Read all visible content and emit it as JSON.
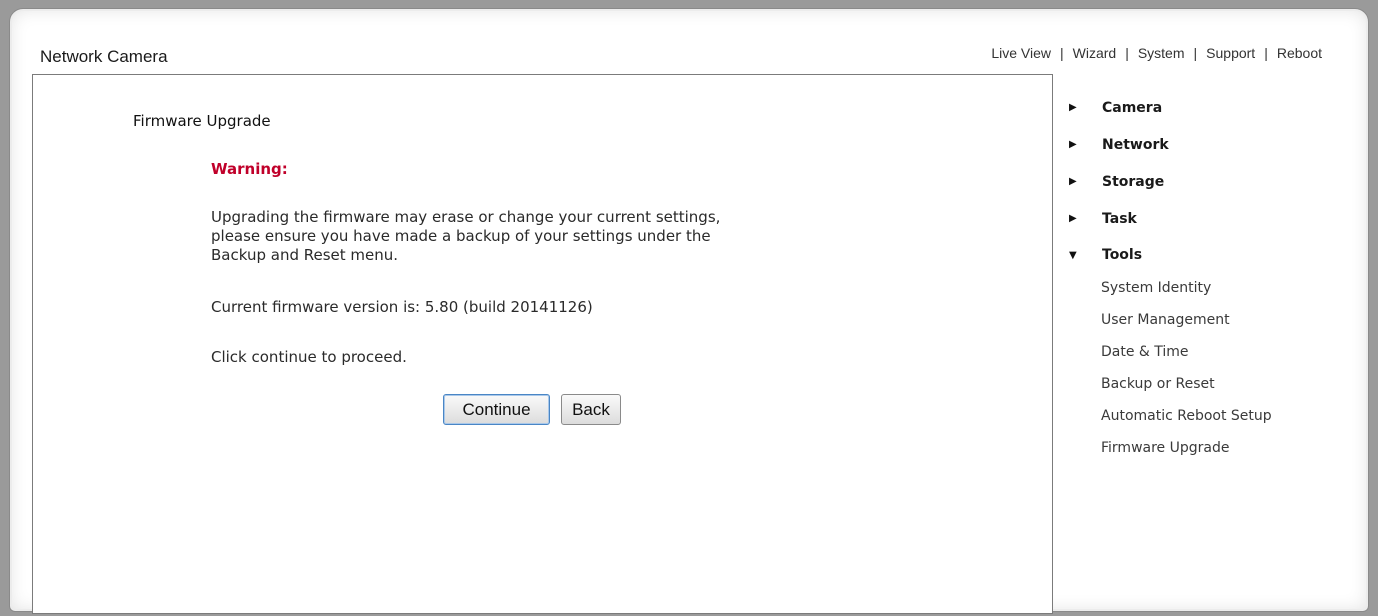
{
  "app": {
    "title": "Network Camera"
  },
  "topnav": {
    "items": [
      "Live View",
      "Wizard",
      "System",
      "Support",
      "Reboot"
    ],
    "separator": "|"
  },
  "main": {
    "page_title": "Firmware Upgrade",
    "warning_heading": "Warning:",
    "warning_text": "Upgrading the firmware may erase or change your current settings,\nplease ensure you have made a backup of your settings under the\nBackup and Reset menu.",
    "version_text": "Current firmware version is: 5.80 (build 20141126)",
    "proceed_text": "Click continue to proceed.",
    "continue_label": "Continue",
    "back_label": "Back"
  },
  "sidebar": {
    "groups": [
      {
        "label": "Camera",
        "expanded": false
      },
      {
        "label": "Network",
        "expanded": false
      },
      {
        "label": "Storage",
        "expanded": false
      },
      {
        "label": "Task",
        "expanded": false
      },
      {
        "label": "Tools",
        "expanded": true
      }
    ],
    "tools_items": [
      "System Identity",
      "User Management",
      "Date & Time",
      "Backup or Reset",
      "Automatic Reboot Setup",
      "Firmware Upgrade"
    ]
  },
  "colors": {
    "warning": "#c0002a",
    "border": "#7b7b7b",
    "accent_button": "#4a86c5"
  },
  "icons": {
    "collapsed": "caret-right-icon",
    "expanded": "caret-down-icon"
  }
}
